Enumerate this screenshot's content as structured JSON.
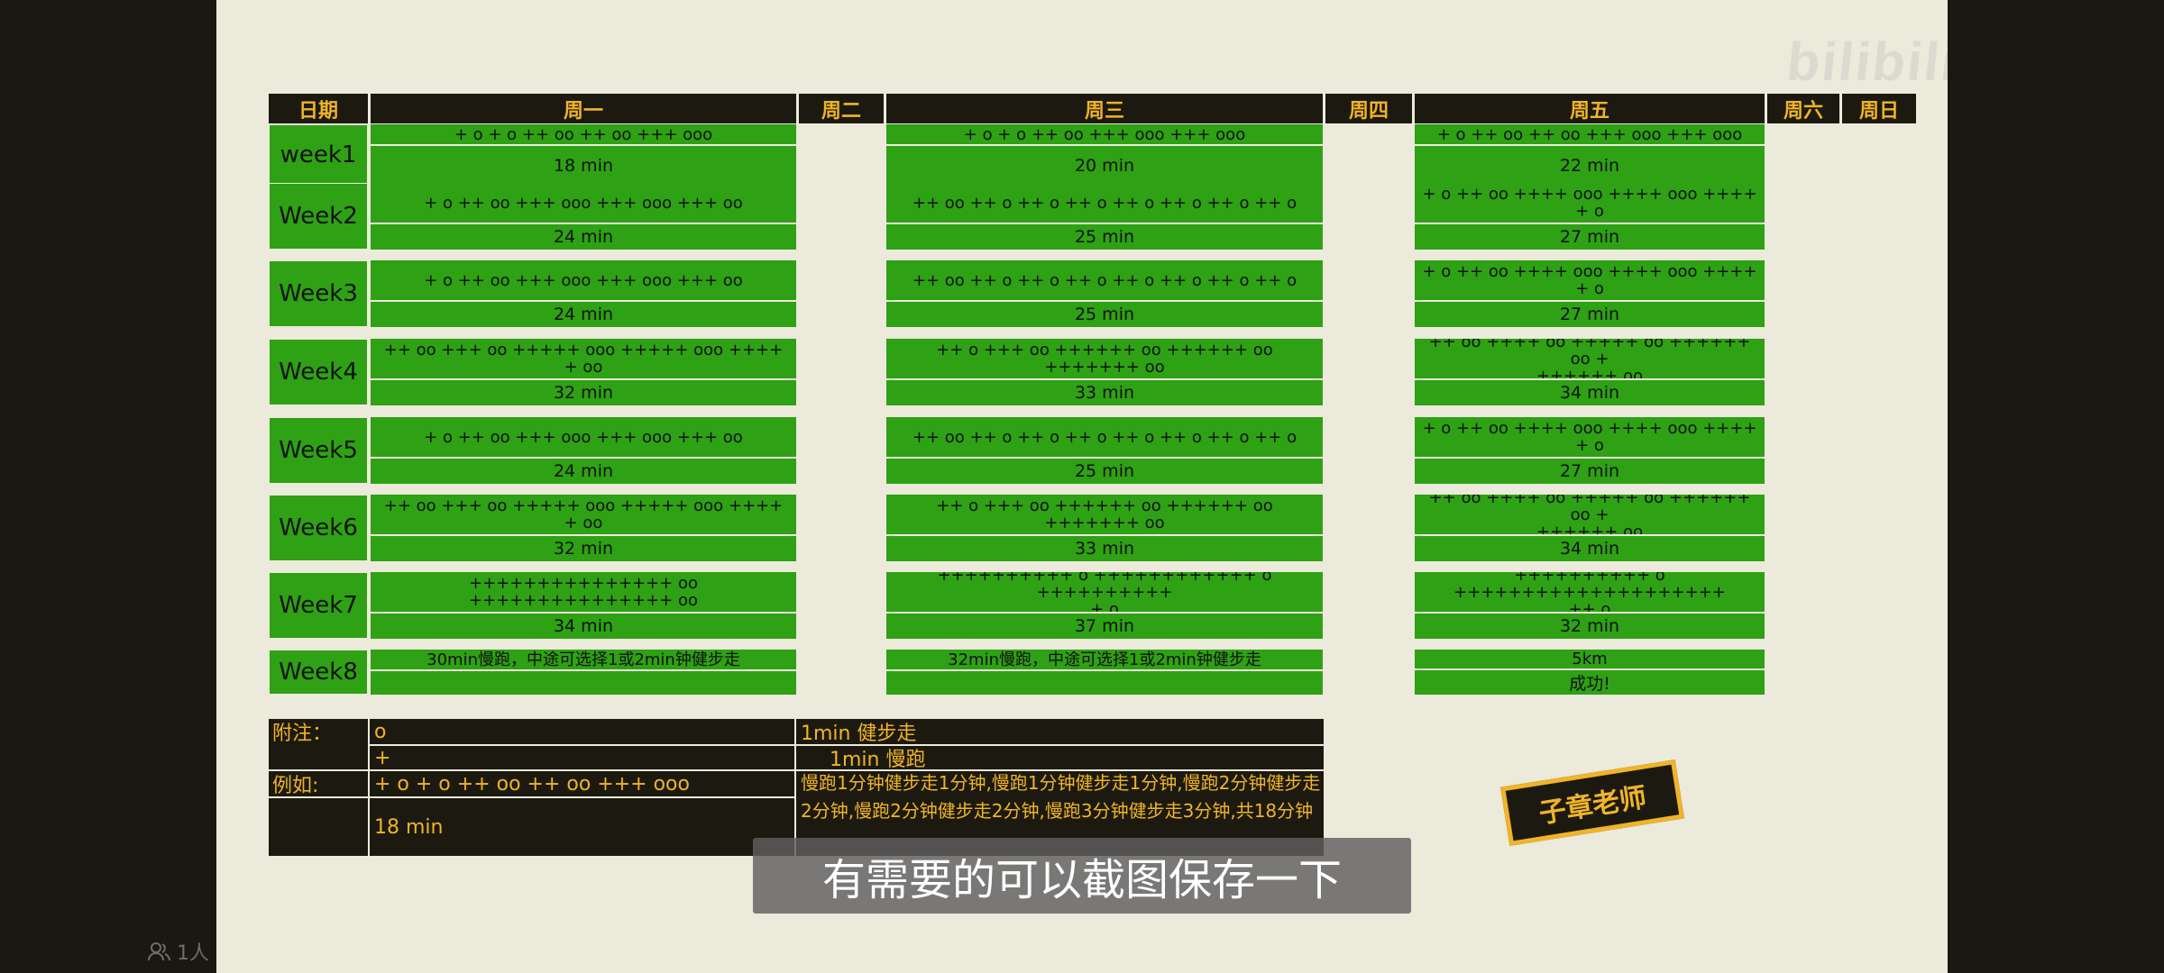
{
  "watermark": "bilibili",
  "headers": [
    "日期",
    "周一",
    "周二",
    "周三",
    "周四",
    "周五",
    "周六",
    "周日"
  ],
  "weeks": [
    {
      "label": "week1",
      "mon": {
        "pattern": "+ o + o ++ oo ++ oo +++ ooo",
        "time": "18 min"
      },
      "wed": {
        "pattern": "+ o + o ++ oo +++ ooo +++ ooo",
        "time": "20 min"
      },
      "fri": {
        "pattern": "+ o ++ oo ++ oo +++ ooo +++ ooo",
        "time": "22 min"
      }
    },
    {
      "label": "Week2",
      "mon": {
        "pattern": "+ o ++ oo +++ ooo +++ ooo +++ oo",
        "time": "24 min"
      },
      "wed": {
        "pattern": "++ oo ++ o ++ o ++ o ++ o ++ o ++ o ++ o",
        "time": "25 min"
      },
      "fri": {
        "pattern": "+ o ++ oo ++++ ooo ++++ ooo ++++\n+ o",
        "time": "27 min"
      }
    },
    {
      "label": "Week3",
      "mon": {
        "pattern": "+ o ++ oo +++ ooo +++ ooo +++ oo",
        "time": "24 min"
      },
      "wed": {
        "pattern": "++ oo ++ o ++ o ++ o ++ o ++ o ++ o ++ o",
        "time": "25 min"
      },
      "fri": {
        "pattern": "+ o ++ oo ++++ ooo ++++ ooo ++++\n+ o",
        "time": "27 min"
      }
    },
    {
      "label": "Week4",
      "mon": {
        "pattern": "++ oo +++ oo +++++ ooo +++++ ooo ++++\n+ oo",
        "time": "32 min"
      },
      "wed": {
        "pattern": "++ o +++ oo ++++++ oo ++++++ oo +++++++ oo",
        "time": "33 min"
      },
      "fri": {
        "pattern": "++ oo ++++ oo +++++ oo ++++++ oo +\n++++++ oo",
        "time": "34 min"
      }
    },
    {
      "label": "Week5",
      "mon": {
        "pattern": "+ o ++ oo +++ ooo +++ ooo +++ oo",
        "time": "24 min"
      },
      "wed": {
        "pattern": "++ oo ++ o ++ o ++ o ++ o ++ o ++ o ++ o",
        "time": "25 min"
      },
      "fri": {
        "pattern": "+ o ++ oo ++++ ooo ++++ ooo ++++\n+ o",
        "time": "27 min"
      }
    },
    {
      "label": "Week6",
      "mon": {
        "pattern": "++ oo +++ oo +++++ ooo +++++ ooo ++++\n+ oo",
        "time": "32 min"
      },
      "wed": {
        "pattern": "++ o +++ oo ++++++ oo ++++++ oo +++++++ oo",
        "time": "33 min"
      },
      "fri": {
        "pattern": "++ oo ++++ oo +++++ oo ++++++ oo +\n++++++ oo",
        "time": "34 min"
      }
    },
    {
      "label": "Week7",
      "mon": {
        "pattern": "+++++++++++++++ oo +++++++++++++++ oo",
        "time": "34 min"
      },
      "wed": {
        "pattern": "++++++++++ o ++++++++++++ o ++++++++++\n+ o",
        "time": "37 min"
      },
      "fri": {
        "pattern": "++++++++++ o ++++++++++++++++++++\n++ o",
        "time": "32 min"
      }
    },
    {
      "label": "Week8",
      "mon": {
        "pattern": "30min慢跑，中途可选择1或2min钟健步走",
        "time": ""
      },
      "wed": {
        "pattern": "32min慢跑，中途可选择1或2min钟健步走",
        "time": ""
      },
      "fri": {
        "pattern": "5km",
        "time": "成功!"
      }
    }
  ],
  "notes": {
    "label1": "附注：",
    "o_symbol": "o",
    "o_meaning": "1min 健步走",
    "plus_symbol": "+",
    "plus_meaning": "1min 慢跑",
    "label2": "例如:",
    "example_pattern": "+ o + o ++ oo ++ oo +++ ooo",
    "example_time": "18 min",
    "example_desc": "慢跑1分钟健步走1分钟,慢跑1分钟健步走1分钟,慢跑2分钟健步走2分钟,慢跑2分钟健步走2分钟,慢跑3分钟健步走3分钟,共18分钟"
  },
  "stamp": "子章老师",
  "subtitle": "有需要的可以截图保存一下",
  "viewer_count": "1人",
  "colors": {
    "frame": "#1b1812",
    "paper": "#eceadb",
    "header": "#1c1a10",
    "accent": "#f0b428",
    "green": "#2ea114"
  }
}
